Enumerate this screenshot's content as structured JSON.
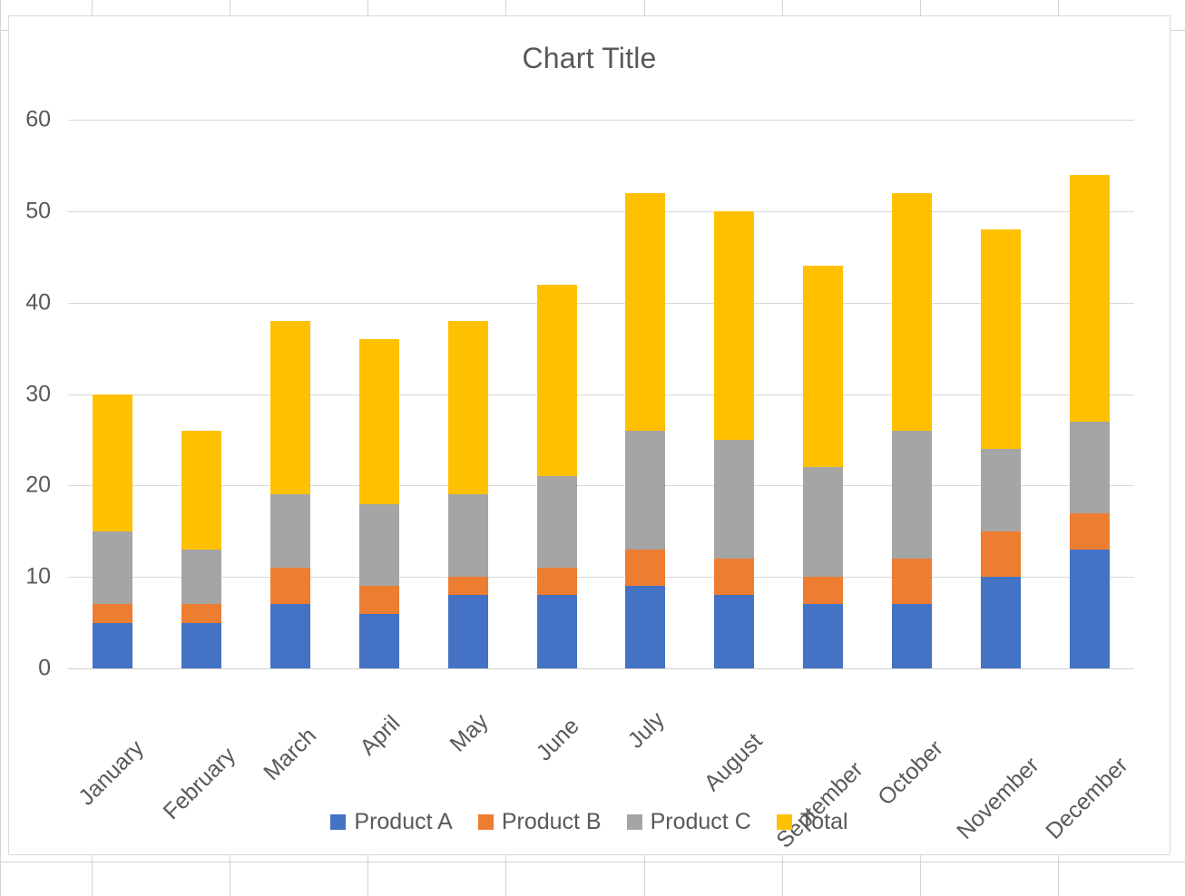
{
  "chart": {
    "title": "Chart Title",
    "legend_position": "bottom"
  },
  "chart_data": {
    "type": "bar",
    "subtype": "stacked",
    "title": "Chart Title",
    "xlabel": "",
    "ylabel": "",
    "ylim": [
      0,
      60
    ],
    "yticks": [
      0,
      10,
      20,
      30,
      40,
      50,
      60
    ],
    "grid": true,
    "legend": [
      "Product A",
      "Product B",
      "Product C",
      "Total"
    ],
    "categories": [
      "January",
      "February",
      "March",
      "April",
      "May",
      "June",
      "July",
      "August",
      "September",
      "October",
      "November",
      "December"
    ],
    "series": [
      {
        "name": "Product A",
        "color": "#4472C4",
        "values": [
          5,
          5,
          7,
          6,
          8,
          8,
          9,
          8,
          7,
          7,
          10,
          13
        ]
      },
      {
        "name": "Product B",
        "color": "#ED7D31",
        "values": [
          2,
          2,
          4,
          3,
          2,
          3,
          4,
          4,
          3,
          5,
          5,
          4
        ]
      },
      {
        "name": "Product C",
        "color": "#A5A5A5",
        "values": [
          8,
          6,
          8,
          9,
          9,
          10,
          13,
          13,
          12,
          14,
          9,
          10
        ]
      },
      {
        "name": "Total",
        "color": "#FFC000",
        "values": [
          15,
          13,
          19,
          18,
          19,
          21,
          26,
          25,
          22,
          26,
          24,
          27
        ]
      }
    ],
    "stack_totals": [
      30,
      26,
      38,
      36,
      38,
      42,
      52,
      50,
      44,
      52,
      48,
      54
    ]
  },
  "colors": {
    "product_a": "#4472C4",
    "product_b": "#ED7D31",
    "product_c": "#A5A5A5",
    "total": "#FFC000",
    "text": "#595959",
    "gridline": "#D9D9D9",
    "sheet_gridline": "#D4D4D4",
    "chart_border": "#D9D9D9",
    "background": "#FFFFFF"
  }
}
